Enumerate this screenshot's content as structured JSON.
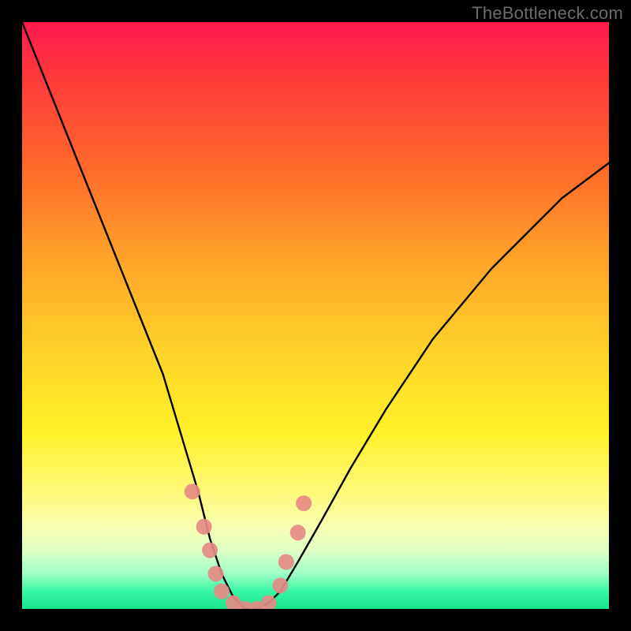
{
  "watermark": "TheBottleneck.com",
  "chart_data": {
    "type": "line",
    "title": "",
    "xlabel": "",
    "ylabel": "",
    "xlim": [
      0,
      100
    ],
    "ylim": [
      0,
      100
    ],
    "background_gradient": {
      "axis": "vertical",
      "stops": [
        {
          "pos": 0,
          "color": "#ff1a4d",
          "meaning": "severe-bottleneck"
        },
        {
          "pos": 50,
          "color": "#ffd029",
          "meaning": "moderate"
        },
        {
          "pos": 100,
          "color": "#18e58e",
          "meaning": "balanced"
        }
      ]
    },
    "series": [
      {
        "name": "bottleneck-curve",
        "x": [
          0,
          4,
          8,
          12,
          16,
          20,
          24,
          27,
          30,
          32,
          34,
          36,
          38,
          40,
          42,
          44,
          47,
          51,
          56,
          62,
          70,
          80,
          92,
          100
        ],
        "y": [
          100,
          90,
          80,
          70,
          60,
          50,
          40,
          30,
          20,
          12,
          6,
          2,
          0,
          0,
          1,
          3,
          8,
          15,
          24,
          34,
          46,
          58,
          70,
          76
        ]
      }
    ],
    "markers": {
      "name": "highlight-dots",
      "color": "#e58b84",
      "points": [
        {
          "x": 29,
          "y": 20
        },
        {
          "x": 31,
          "y": 14
        },
        {
          "x": 32,
          "y": 10
        },
        {
          "x": 33,
          "y": 6
        },
        {
          "x": 34,
          "y": 3
        },
        {
          "x": 36,
          "y": 1
        },
        {
          "x": 38,
          "y": 0
        },
        {
          "x": 40,
          "y": 0
        },
        {
          "x": 42,
          "y": 1
        },
        {
          "x": 44,
          "y": 4
        },
        {
          "x": 45,
          "y": 8
        },
        {
          "x": 47,
          "y": 13
        },
        {
          "x": 48,
          "y": 18
        }
      ]
    },
    "optimal_x": 39
  }
}
